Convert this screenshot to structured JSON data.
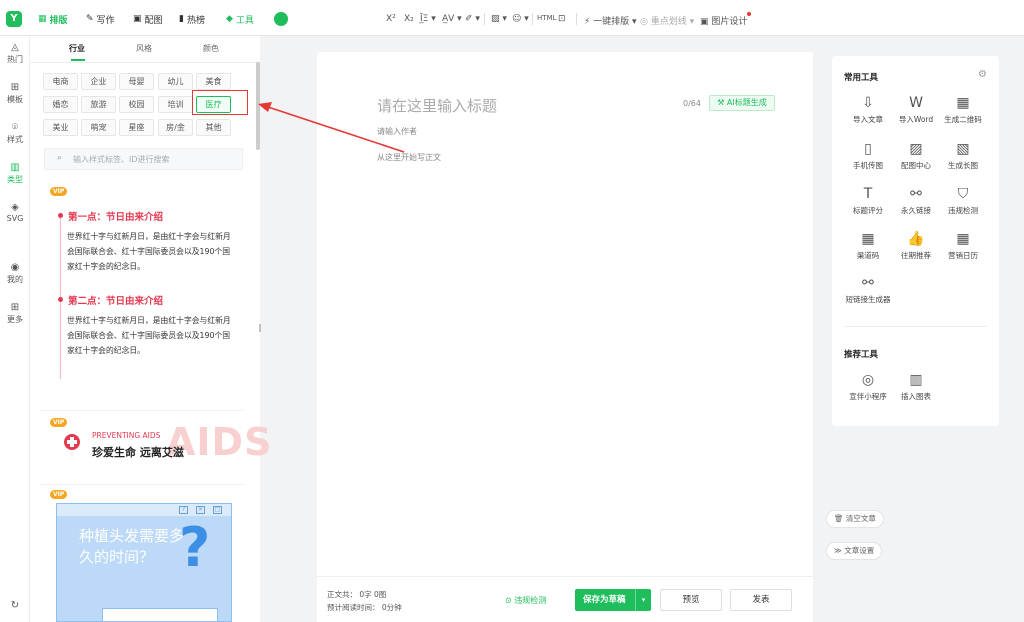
{
  "brand": {
    "logo_letter": "Y"
  },
  "topnav": [
    {
      "label": "排版",
      "icon": "▦",
      "active": true
    },
    {
      "label": "写作",
      "icon": "✎"
    },
    {
      "label": "配图",
      "icon": "▣"
    },
    {
      "label": "热榜",
      "icon": "▮"
    },
    {
      "label": "工具",
      "icon": "◆"
    }
  ],
  "toolbar": {
    "sup": "X²",
    "sub": "X₂",
    "indent": "Ī̲Ξ ▾",
    "spacing": "A̲V ▾",
    "clear": "✐ ▾",
    "image": "▨ ▾",
    "emoji": "☺ ▾",
    "html": "HTML",
    "briefcase": "⊡",
    "one_click": "⚡ 一键排版 ▾",
    "mark": "◎ 重点划线 ▾",
    "image_design": "▣ 图片设计"
  },
  "leftnav": [
    {
      "icon": "◬",
      "label": "热门"
    },
    {
      "icon": "⊞",
      "label": "模板"
    },
    {
      "icon": "⌾",
      "label": "样式"
    },
    {
      "icon": "▥",
      "label": "类型",
      "active": true
    },
    {
      "icon": "◈",
      "label": "SVG"
    },
    {
      "icon": "◉",
      "label": "我的"
    },
    {
      "icon": "⊞",
      "label": "更多"
    },
    {
      "icon": "↻",
      "label": ""
    }
  ],
  "panel": {
    "tabs": [
      "行业",
      "风格",
      "颜色"
    ],
    "chips": [
      [
        "电商",
        "企业",
        "母婴",
        "幼儿",
        "美食"
      ],
      [
        "婚恋",
        "旅游",
        "校园",
        "培训",
        "医疗"
      ],
      [
        "美业",
        "萌宠",
        "星座",
        "房/金",
        "其他"
      ]
    ],
    "search_placeholder": "输入样式标签、ID进行搜索",
    "vip": "VIP",
    "template1": {
      "h1": "第一点：节日由来介绍",
      "p1": "世界红十字与红新月日，是由红十字会与红新月会国际联合会、红十字国际委员会以及190个国家红十字会的纪念日。",
      "h2": "第二点：节日由来介绍",
      "p2": "世界红十字与红新月日，是由红十字会与红新月会国际联合会、红十字国际委员会以及190个国家红十字会的纪念日。"
    },
    "template2": {
      "en": "PREVENTING AIDS",
      "cn": "珍爱生命 远离艾滋",
      "bg": "AIDS"
    },
    "template3": {
      "title": "种植头发需要多久的时间？",
      "q": "?",
      "win": [
        "?",
        "✕",
        "□"
      ]
    }
  },
  "editor": {
    "title_placeholder": "请在这里输入标题",
    "count": "0/64",
    "ai_button": "⚒ AI标题生成",
    "author_placeholder": "请输入作者",
    "body_placeholder": "从这里开始写正文"
  },
  "bottom": {
    "stats1": "正文共： 0字 0图",
    "stats2": "预计阅读时间： 0分钟",
    "check": "⊙ 违规检测",
    "save": "保存为草稿",
    "save_dd": "▾",
    "preview": "预览",
    "publish": "发表"
  },
  "rightpanel": {
    "common_title": "常用工具",
    "tools": [
      {
        "icon": "⇩",
        "label": "导入文章"
      },
      {
        "icon": "W",
        "label": "导入Word"
      },
      {
        "icon": "▦",
        "label": "生成二维码"
      },
      {
        "icon": "▯",
        "label": "手机传图"
      },
      {
        "icon": "▨",
        "label": "配图中心"
      },
      {
        "icon": "▧",
        "label": "生成长图"
      },
      {
        "icon": "T",
        "label": "标题评分"
      },
      {
        "icon": "⚯",
        "label": "永久链接"
      },
      {
        "icon": "⛉",
        "label": "违规检测"
      },
      {
        "icon": "▦",
        "label": "渠道码"
      },
      {
        "icon": "👍",
        "label": "往期推荐"
      },
      {
        "icon": "▦",
        "label": "营销日历"
      },
      {
        "icon": "⚯",
        "label": "短链接生成器"
      }
    ],
    "rec_title": "推荐工具",
    "rec_tools": [
      {
        "icon": "◎",
        "label": "宣伴小程序"
      },
      {
        "icon": "▥",
        "label": "插入图表"
      }
    ],
    "settings_icon": "⚙"
  },
  "side": {
    "clear": "🗑 清空文章",
    "settings": "≫ 文章设置"
  },
  "colors": {
    "accent": "#1ebe5d",
    "highlight": "#e53935"
  }
}
